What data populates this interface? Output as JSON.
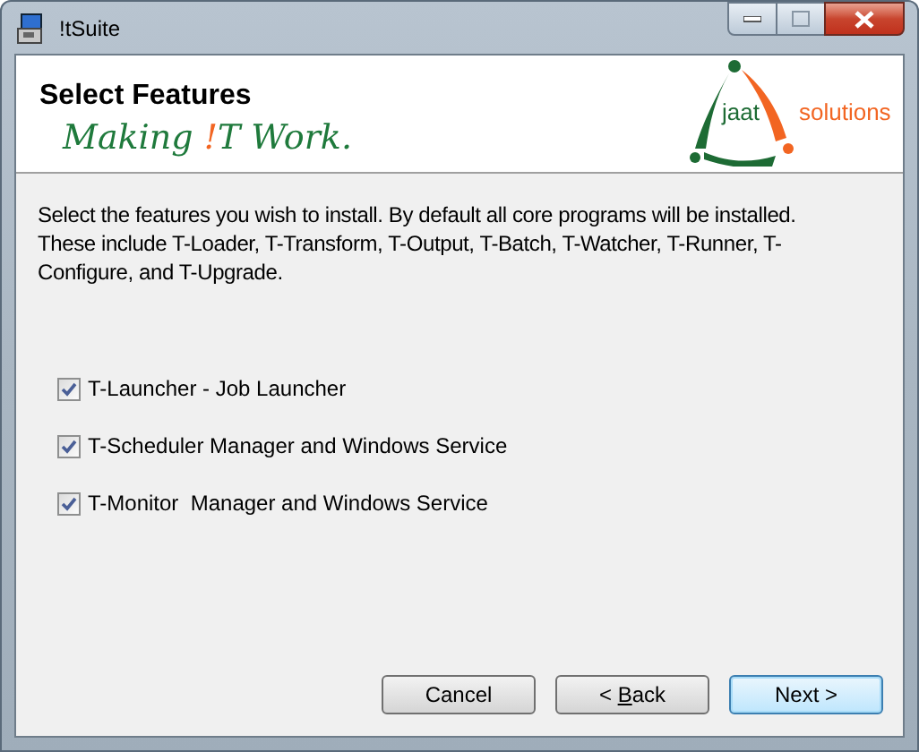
{
  "window": {
    "title": "!tSuite"
  },
  "header": {
    "title": "Select Features",
    "tagline": [
      {
        "text": "Making ",
        "color": "#1f7a3c"
      },
      {
        "text": "!",
        "color": "#f26522"
      },
      {
        "text": "T Work.",
        "color": "#1f7a3c"
      }
    ],
    "logo": {
      "name": "jaat",
      "suffix": "solutions"
    }
  },
  "description": "Select the features you wish to install. By default all core programs will be installed. These include T-Loader, T-Transform, T-Output, T-Batch, T-Watcher, T-Runner, T-Configure, and T-Upgrade.",
  "features": [
    {
      "label": "T-Launcher - Job Launcher",
      "checked": true
    },
    {
      "label": "T-Scheduler Manager and Windows Service",
      "checked": true
    },
    {
      "label": "T-Monitor  Manager and Windows Service",
      "checked": true
    }
  ],
  "buttons": [
    {
      "parts": [
        {
          "text": "Cancel",
          "underlined": false
        }
      ],
      "default": false
    },
    {
      "parts": [
        {
          "text": "< ",
          "underlined": false
        },
        {
          "text": "B",
          "underlined": true
        },
        {
          "text": "ack",
          "underlined": false
        }
      ],
      "default": false
    },
    {
      "parts": [
        {
          "text": "Next >",
          "underlined": false
        }
      ],
      "default": true
    }
  ]
}
